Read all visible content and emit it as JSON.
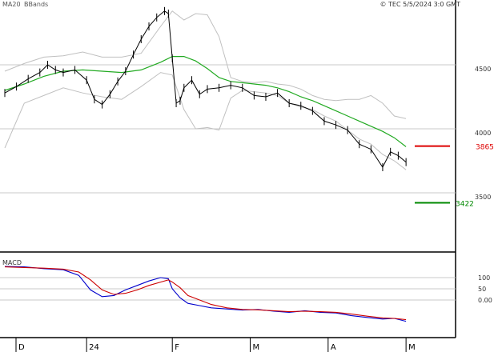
{
  "header": {
    "ma_label": "MA20",
    "bb_label": "BBands",
    "copyright": "© TEC 5/5/2024 3:0 GMT"
  },
  "colors": {
    "ma20": "#22aa22",
    "bbands": "#c0c0c0",
    "price": "#000000",
    "resistance": "#dd0000",
    "support": "#008800",
    "macd": "#0000cc",
    "signal": "#cc0000",
    "grid": "#c8c8c8"
  },
  "chart_data": [
    {
      "type": "line",
      "panel": "price",
      "title": "",
      "y_ticks": [
        {
          "value": 4500,
          "label": "4500"
        },
        {
          "value": 4000,
          "label": "4000"
        },
        {
          "value": 3500,
          "label": "3500"
        }
      ],
      "ylim": [
        3000,
        5000
      ],
      "x_labels": [
        {
          "index": 0,
          "label": "D"
        },
        {
          "index": 21,
          "label": "24"
        },
        {
          "index": 43,
          "label": "F"
        },
        {
          "index": 63,
          "label": "M"
        },
        {
          "index": 83,
          "label": "A"
        },
        {
          "index": 103,
          "label": "M"
        }
      ],
      "x_count": 105,
      "levels": [
        {
          "name": "resistance",
          "value": 3865,
          "label": "3865"
        },
        {
          "name": "support",
          "value": 3422,
          "label": "3422"
        }
      ],
      "series": [
        {
          "name": "MA20",
          "x": [
            0,
            5,
            10,
            15,
            20,
            25,
            30,
            35,
            40,
            43,
            46,
            49,
            52,
            55,
            58,
            61,
            64,
            67,
            70,
            73,
            76,
            79,
            82,
            85,
            88,
            91,
            94,
            97,
            100,
            103
          ],
          "values": [
            4300,
            4350,
            4410,
            4450,
            4460,
            4450,
            4440,
            4460,
            4520,
            4565,
            4565,
            4530,
            4470,
            4400,
            4370,
            4360,
            4350,
            4340,
            4320,
            4290,
            4250,
            4220,
            4180,
            4140,
            4100,
            4060,
            4020,
            3980,
            3930,
            3860
          ]
        },
        {
          "name": "Upper BBand",
          "x": [
            0,
            5,
            10,
            15,
            20,
            25,
            30,
            35,
            40,
            43,
            46,
            49,
            52,
            55,
            58,
            61,
            64,
            67,
            70,
            73,
            76,
            79,
            82,
            85,
            88,
            91,
            94,
            97,
            100,
            103
          ],
          "values": [
            4450,
            4510,
            4560,
            4570,
            4600,
            4560,
            4560,
            4590,
            4800,
            4920,
            4850,
            4900,
            4890,
            4720,
            4400,
            4370,
            4360,
            4370,
            4350,
            4340,
            4310,
            4260,
            4230,
            4220,
            4230,
            4230,
            4260,
            4200,
            4100,
            4080
          ]
        },
        {
          "name": "Lower BBand",
          "x": [
            0,
            5,
            10,
            15,
            20,
            25,
            30,
            35,
            40,
            43,
            46,
            49,
            52,
            55,
            58,
            61,
            64,
            67,
            70,
            73,
            76,
            79,
            82,
            85,
            88,
            91,
            94,
            97,
            100,
            103
          ],
          "values": [
            3850,
            4200,
            4260,
            4320,
            4280,
            4250,
            4230,
            4330,
            4440,
            4420,
            4150,
            4000,
            4010,
            3990,
            4240,
            4300,
            4290,
            4280,
            4260,
            4200,
            4170,
            4150,
            4100,
            4060,
            3990,
            3920,
            3880,
            3800,
            3750,
            3680
          ]
        },
        {
          "name": "Price",
          "x": [
            0,
            3,
            6,
            9,
            11,
            13,
            15,
            18,
            21,
            23,
            25,
            27,
            29,
            31,
            33,
            35,
            37,
            39,
            41,
            42,
            43,
            44,
            45,
            46,
            48,
            50,
            52,
            55,
            58,
            61,
            64,
            67,
            70,
            73,
            76,
            79,
            82,
            85,
            88,
            91,
            94,
            97,
            99,
            101,
            103
          ],
          "values": [
            4280,
            4330,
            4390,
            4440,
            4500,
            4460,
            4440,
            4460,
            4380,
            4230,
            4190,
            4270,
            4370,
            4450,
            4580,
            4700,
            4800,
            4870,
            4920,
            4900,
            4550,
            4200,
            4220,
            4320,
            4380,
            4270,
            4310,
            4320,
            4340,
            4320,
            4260,
            4250,
            4280,
            4200,
            4180,
            4140,
            4060,
            4030,
            3990,
            3880,
            3840,
            3700,
            3820,
            3790,
            3740
          ]
        }
      ]
    },
    {
      "type": "line",
      "panel": "indicator",
      "title": "MACD",
      "y_ticks": [
        {
          "value": 100,
          "label": "100"
        },
        {
          "value": 50,
          "label": "50"
        },
        {
          "value": 0,
          "label": "0.00"
        }
      ],
      "ylim": [
        -120,
        180
      ],
      "series": [
        {
          "name": "MACD",
          "x": [
            0,
            5,
            10,
            15,
            19,
            22,
            25,
            28,
            31,
            34,
            37,
            40,
            42,
            43,
            45,
            47,
            50,
            53,
            57,
            61,
            65,
            69,
            73,
            77,
            81,
            85,
            89,
            93,
            97,
            100,
            103
          ],
          "values": [
            150,
            148,
            140,
            135,
            110,
            45,
            15,
            20,
            45,
            65,
            85,
            100,
            95,
            50,
            10,
            -15,
            -25,
            -35,
            -40,
            -45,
            -42,
            -50,
            -55,
            -48,
            -55,
            -58,
            -70,
            -78,
            -85,
            -82,
            -95
          ]
        },
        {
          "name": "Signal",
          "x": [
            0,
            5,
            10,
            15,
            19,
            22,
            25,
            28,
            31,
            34,
            37,
            40,
            42,
            43,
            45,
            47,
            50,
            53,
            57,
            61,
            65,
            69,
            73,
            77,
            81,
            85,
            89,
            93,
            97,
            100,
            103
          ],
          "values": [
            148,
            145,
            142,
            138,
            125,
            90,
            45,
            25,
            30,
            45,
            65,
            80,
            90,
            80,
            55,
            20,
            0,
            -20,
            -35,
            -42,
            -44,
            -48,
            -52,
            -50,
            -52,
            -55,
            -63,
            -72,
            -80,
            -82,
            -88
          ]
        }
      ]
    }
  ]
}
